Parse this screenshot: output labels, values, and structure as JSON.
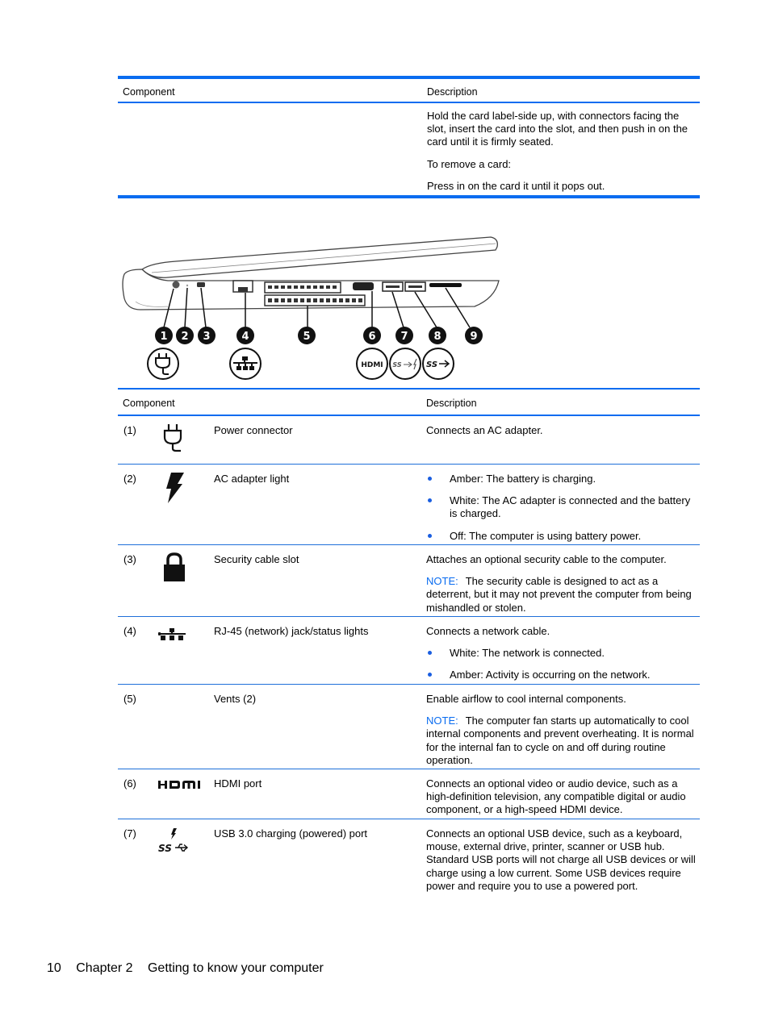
{
  "top_table": {
    "header": {
      "component": "Component",
      "description": "Description"
    },
    "description_paragraphs": [
      "Hold the card label-side up, with connectors facing the slot, insert the card into the slot, and then push in on the card until it is firmly seated.",
      "To remove a card:",
      "Press in on the card it until it pops out."
    ]
  },
  "diagram": {
    "callouts": [
      "1",
      "2",
      "3",
      "4",
      "5",
      "6",
      "7",
      "8",
      "9"
    ],
    "port_icons": [
      "power-plug-icon",
      "network-icon",
      "hdmi-icon",
      "usb-charging-icon",
      "usb-ss-icon"
    ],
    "hdmi_text": "HDMI",
    "ss_text": "SS"
  },
  "main_table": {
    "header": {
      "component": "Component",
      "description": "Description"
    },
    "note_label": "NOTE:",
    "rows": [
      {
        "num": "(1)",
        "icon": "power-plug-icon",
        "name": "Power connector",
        "paragraphs": [
          "Connects an AC adapter."
        ]
      },
      {
        "num": "(2)",
        "icon": "lightning-bolt-icon",
        "name": "AC adapter light",
        "bullets": [
          "Amber: The battery is charging.",
          "White: The AC adapter is connected and the battery is charged.",
          "Off: The computer is using battery power."
        ]
      },
      {
        "num": "(3)",
        "icon": "padlock-icon",
        "name": "Security cable slot",
        "paragraphs": [
          "Attaches an optional security cable to the computer."
        ],
        "note": "The security cable is designed to act as a deterrent, but it may not prevent the computer from being mishandled or stolen."
      },
      {
        "num": "(4)",
        "icon": "network-icon",
        "name": "RJ-45 (network) jack/status lights",
        "paragraphs": [
          "Connects a network cable."
        ],
        "bullets": [
          "White: The network is connected.",
          "Amber: Activity is occurring on the network."
        ]
      },
      {
        "num": "(5)",
        "icon": "",
        "name": "Vents (2)",
        "paragraphs": [
          "Enable airflow to cool internal components."
        ],
        "note": "The computer fan starts up automatically to cool internal components and prevent overheating. It is normal for the internal fan to cycle on and off during routine operation."
      },
      {
        "num": "(6)",
        "icon": "hdmi-icon",
        "name": "HDMI port",
        "paragraphs": [
          "Connects an optional video or audio device, such as a high-definition television, any compatible digital or audio component, or a high-speed HDMI device."
        ]
      },
      {
        "num": "(7)",
        "icon": "usb-charging-icon",
        "name": "USB 3.0 charging (powered) port",
        "paragraphs": [
          "Connects an optional USB device, such as a keyboard, mouse, external drive, printer, scanner or USB hub. Standard USB ports will not charge all USB devices or will charge using a low current. Some USB devices require power and require you to use a powered port."
        ]
      }
    ]
  },
  "footer": {
    "page_number": "10",
    "chapter": "Chapter 2",
    "title": "Getting to know your computer"
  },
  "colors": {
    "accent_blue": "#0a6cf0",
    "bullet_blue": "#1a5ee0"
  }
}
